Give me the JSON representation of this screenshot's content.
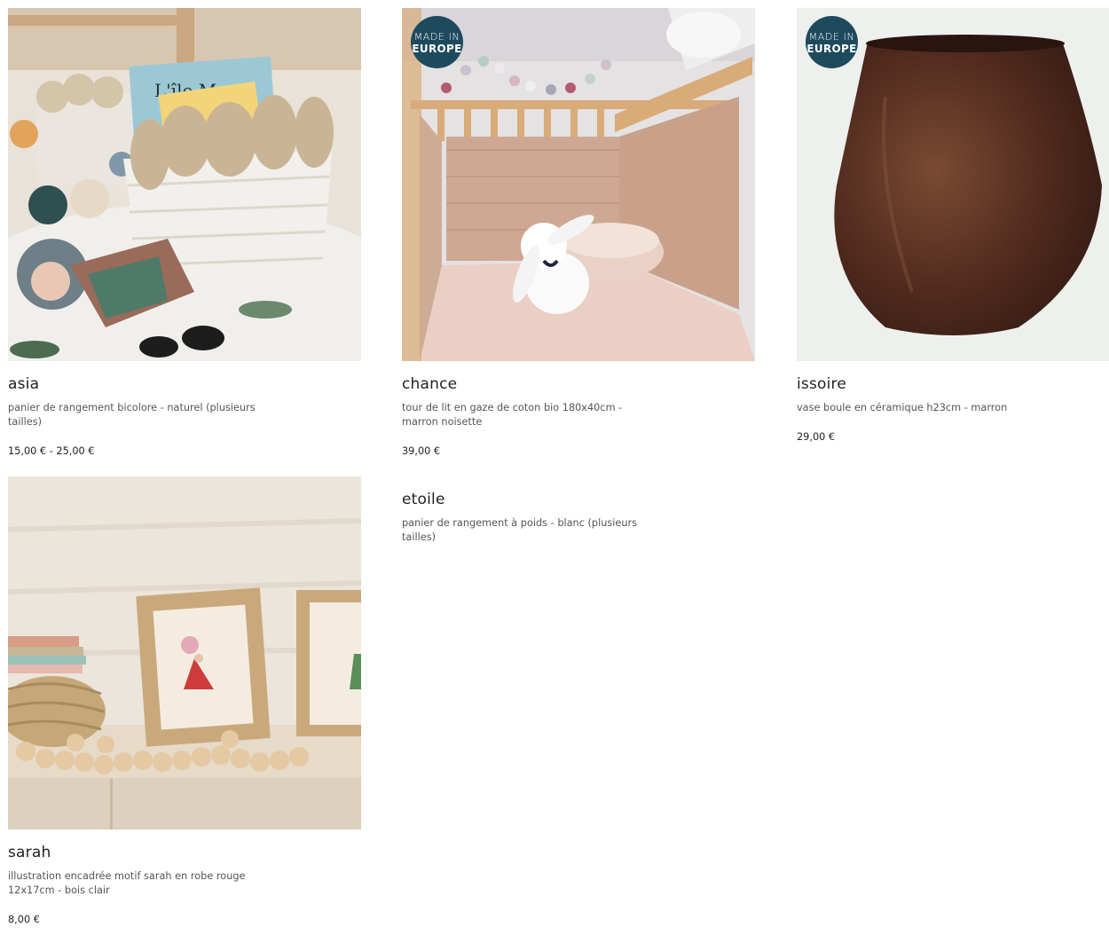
{
  "products": [
    {
      "name": "asia",
      "description": "panier de rangement bicolore - naturel (plusieurs tailles)",
      "price": "15,00 € - 25,00 €",
      "image": "photo of white and natural rope storage baskets with books and rag doll"
    },
    {
      "name": "chance",
      "description": "tour de lit en gaze de coton bio 180x40cm - marron noisette",
      "price": "39,00 €",
      "badge": {
        "line1": "MADE IN",
        "line2": "EUROPE"
      }
    },
    {
      "name": "issoire",
      "description": "vase boule en céramique h23cm - marron",
      "price": "29,00 €",
      "badge": {
        "line1": "MADE IN",
        "line2": "EUROPE"
      }
    },
    {
      "name": "etoile",
      "description": "panier de rangement à poids - blanc (plusieurs tailles)"
    },
    {
      "name": "sarah",
      "description": "illustration encadrée motif sarah en robe rouge 12x17cm - bois clair",
      "price": "8,00 €"
    }
  ],
  "colors": {
    "badge": "#1e4a5e",
    "text": "#222222",
    "muted": "#555555"
  }
}
